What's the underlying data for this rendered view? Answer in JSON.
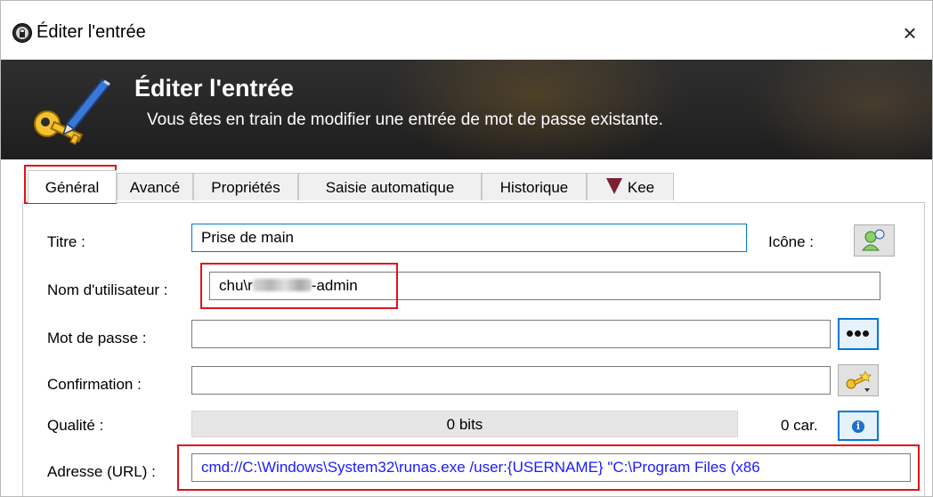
{
  "window": {
    "title": "Éditer l'entrée",
    "close_glyph": "×",
    "app_icon": "keepass-lock-icon"
  },
  "banner": {
    "title": "Éditer l'entrée",
    "subtitle": "Vous êtes en train de modifier une entrée de mot de passe existante.",
    "icon": "key-pen-icon"
  },
  "tabs": [
    {
      "label": "Général",
      "active": true
    },
    {
      "label": "Avancé"
    },
    {
      "label": "Propriétés"
    },
    {
      "label": "Saisie automatique"
    },
    {
      "label": "Historique"
    },
    {
      "label": "Kee",
      "icon": "kee-icon"
    }
  ],
  "form": {
    "title_label": "Titre :",
    "title_value": "Prise de main",
    "icon_label": "Icône :",
    "username_label": "Nom d'utilisateur :",
    "username_prefix": "chu\\r",
    "username_suffix": "-admin",
    "password_label": "Mot de passe :",
    "password_value": "",
    "confirm_label": "Confirmation :",
    "confirm_value": "",
    "quality_label": "Qualité :",
    "quality_text": "0 bits",
    "quality_chars": "0 car.",
    "url_label": "Adresse (URL) :",
    "url_value": "cmd://C:\\Windows\\System32\\runas.exe /user:{USERNAME} \"C:\\Program Files (x86"
  },
  "colors": {
    "highlight": "#e0121a",
    "url_text": "#1a1aff",
    "focus_border": "#0078d7"
  }
}
